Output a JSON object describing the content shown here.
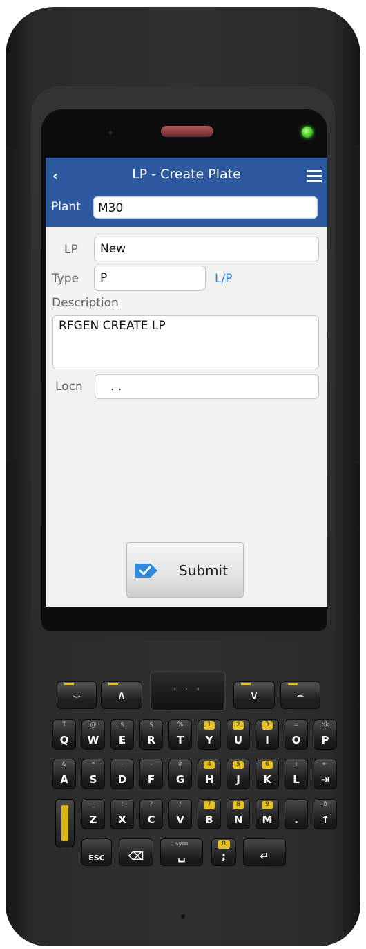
{
  "header": {
    "title": "LP - Create Plate",
    "back_icon": "chevron-left-icon",
    "menu_icon": "hamburger-menu-icon"
  },
  "plant": {
    "label": "Plant",
    "value": "M30"
  },
  "form": {
    "lp_label": "LP",
    "lp_value": "New",
    "type_label": "Type",
    "type_value": "P",
    "type_link": "L/P",
    "description_label": "Description",
    "description_value": "RFGEN CREATE LP",
    "locn_label": "Locn",
    "locn_value": ".   ."
  },
  "submit": {
    "label": "Submit",
    "icon": "checkmark-tag-icon"
  },
  "keypad": {
    "nav_center": "· · ·",
    "row1": [
      {
        "main": "Q",
        "sub": "T"
      },
      {
        "main": "W",
        "sub": "@"
      },
      {
        "main": "E",
        "sub": "$"
      },
      {
        "main": "R",
        "sub": "$"
      },
      {
        "main": "T",
        "sub": "%"
      },
      {
        "main": "Y",
        "sub": "1"
      },
      {
        "main": "U",
        "sub": "2"
      },
      {
        "main": "I",
        "sub": "3"
      },
      {
        "main": "O",
        "sub": "="
      },
      {
        "main": "P",
        "sub": "ok"
      }
    ],
    "row2": [
      {
        "main": "A",
        "sub": "&"
      },
      {
        "main": "S",
        "sub": "*"
      },
      {
        "main": "D",
        "sub": "-"
      },
      {
        "main": "F",
        "sub": "-"
      },
      {
        "main": "G",
        "sub": "#"
      },
      {
        "main": "H",
        "sub": "4"
      },
      {
        "main": "J",
        "sub": "5"
      },
      {
        "main": "K",
        "sub": "6"
      },
      {
        "main": "L",
        "sub": "+"
      },
      {
        "main": "⇥",
        "sub": "⇤"
      }
    ],
    "row3": [
      {
        "main": "Z",
        "sub": "_"
      },
      {
        "main": "X",
        "sub": "!"
      },
      {
        "main": "C",
        "sub": "?"
      },
      {
        "main": "V",
        "sub": "/"
      },
      {
        "main": "B",
        "sub": "7"
      },
      {
        "main": "N",
        "sub": "8"
      },
      {
        "main": "M",
        "sub": "9"
      },
      {
        "main": ".",
        "sub": ""
      },
      {
        "main": "↑",
        "sub": "ô"
      }
    ],
    "row4": [
      {
        "main": "ESC",
        "sub": ""
      },
      {
        "main": "⌫",
        "sub": ""
      },
      {
        "main": "␣",
        "sub": "sym"
      },
      {
        "main": ";",
        "sub": "0"
      },
      {
        "main": "↵",
        "sub": ""
      }
    ]
  },
  "colors": {
    "accent": "#2c58a0",
    "link": "#2f7fcf",
    "led": "#3ec51a"
  }
}
